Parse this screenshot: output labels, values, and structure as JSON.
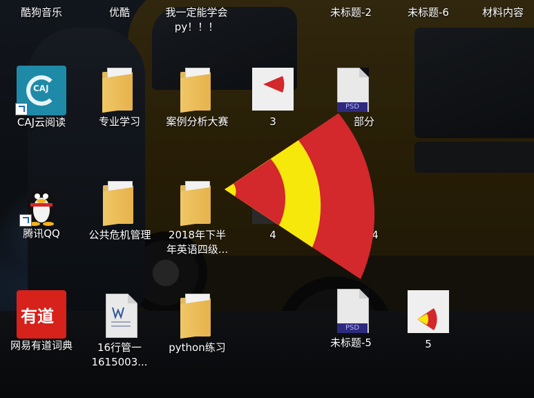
{
  "desktop": {
    "icons": [
      {
        "label": "酷狗音乐"
      },
      {
        "label": "优酷"
      },
      {
        "label": "我一定能学会\npy！！！"
      },
      {
        "label": "未标题-2"
      },
      {
        "label": "未标题-6"
      },
      {
        "label": "材料内容"
      },
      {
        "label": "CAJ云阅读"
      },
      {
        "label": "专业学习"
      },
      {
        "label": "案例分析大赛"
      },
      {
        "label": "3"
      },
      {
        "label": "部分"
      },
      {
        "label": "腾讯QQ"
      },
      {
        "label": "公共危机管理"
      },
      {
        "label": "2018年下半\n年英语四级..."
      },
      {
        "label": "4"
      },
      {
        "label": "4"
      },
      {
        "label": "网易有道词典"
      },
      {
        "label": "16行管一\n1615003..."
      },
      {
        "label": "python练习"
      },
      {
        "label": "未标题-5"
      },
      {
        "label": "5"
      }
    ],
    "psd_badge": "PSD",
    "caj_badge": "CAJ",
    "youdao_badge": "有道"
  },
  "drag_overlay": {
    "shape": "fan",
    "colors": {
      "outer": "#d3282c",
      "middle": "#f7e80c",
      "inner": "#d3282c"
    }
  }
}
